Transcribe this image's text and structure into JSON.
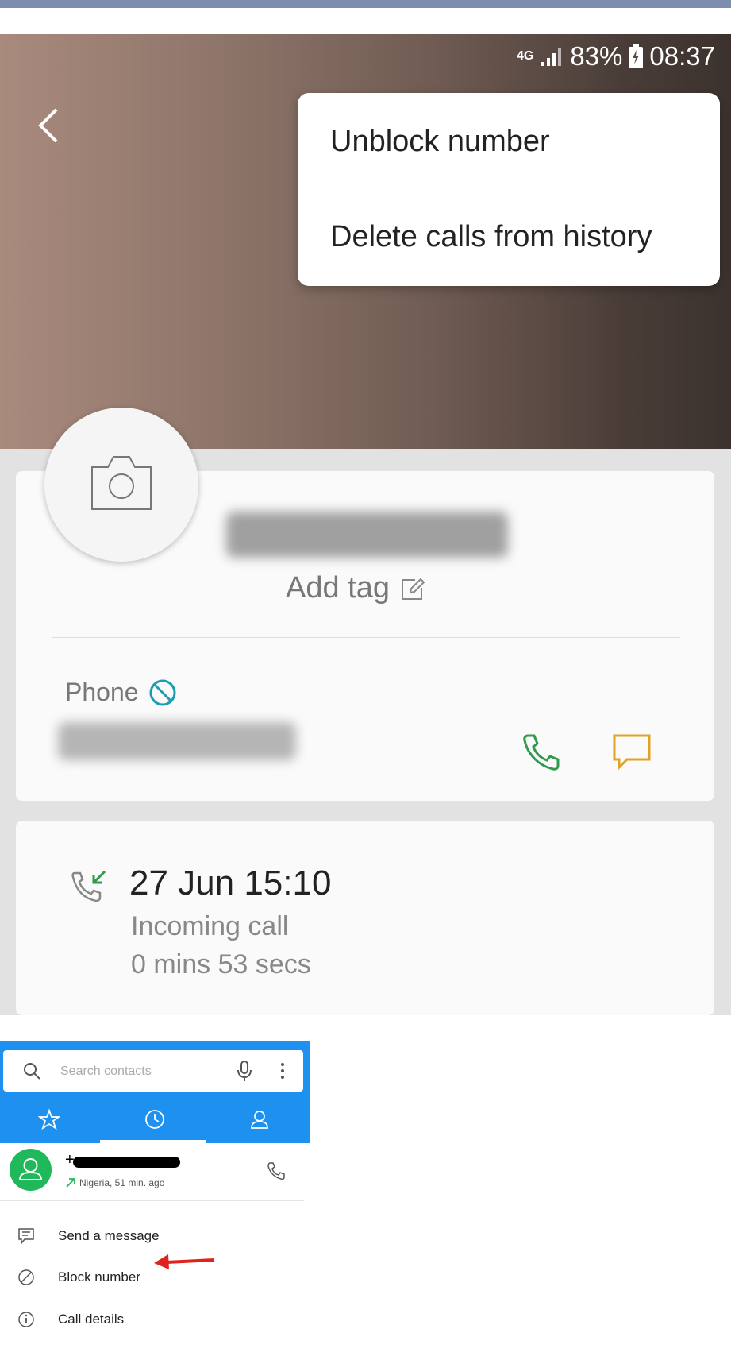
{
  "status_bar": {
    "network": "4G",
    "battery": "83%",
    "time": "08:37"
  },
  "menu": {
    "items": [
      "Unblock number",
      "Delete calls from history"
    ]
  },
  "contact_card": {
    "add_tag_label": "Add tag",
    "phone_label": "Phone"
  },
  "call_log": {
    "date": "27 Jun 15:10",
    "type": "Incoming call",
    "duration": "0 mins 53 secs"
  },
  "app2": {
    "search": {
      "placeholder": "Search contacts"
    },
    "tabs": [
      "favorites-icon",
      "recent-icon",
      "contacts-icon"
    ],
    "contact": {
      "prefix": "+",
      "meta": "Nigeria, 51 min. ago"
    },
    "actions": [
      "Send a message",
      "Block number",
      "Call details"
    ]
  },
  "colors": {
    "accent_blue": "#1e90f0",
    "avatar_green": "#1fb85a",
    "annotation_red": "#e0241c"
  }
}
